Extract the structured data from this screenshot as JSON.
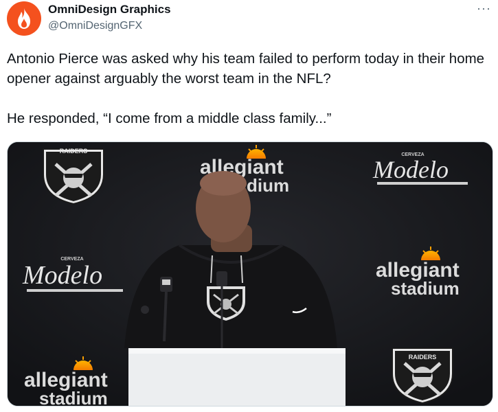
{
  "author": {
    "name": "OmniDesign Graphics",
    "handle": "@OmniDesignGFX",
    "avatar_icon": "flame-icon",
    "avatar_color": "#f4511e"
  },
  "more_icon": "more-icon",
  "more_label": "···",
  "tweet": {
    "paragraphs": [
      "Antonio Pierce was asked why his team failed to perform today in their home opener against arguably the worst team in the NFL?",
      "He responded, “I come from a middle class family...”"
    ]
  },
  "media": {
    "backdrop_logos": {
      "raiders": "RAIDERS",
      "modelo": "Modelo",
      "modelo_top": "CERVEZA",
      "allegiant_1": "allegiant",
      "allegiant_2": "stadium",
      "allegiant_partial": "dium"
    }
  }
}
